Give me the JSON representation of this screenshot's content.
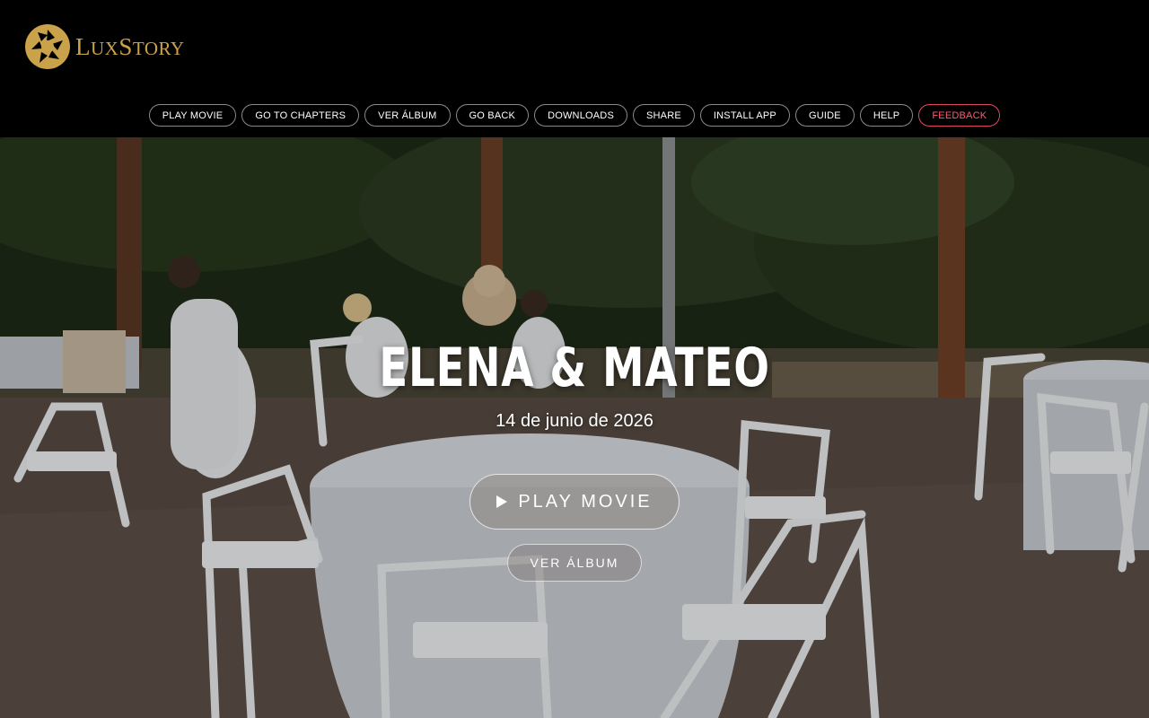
{
  "brand": {
    "name_first": "L",
    "name_rest": "UX",
    "name_second": "S",
    "name_second_rest": "TORY",
    "logo_icon": "aperture-logo-icon",
    "accent": "#c9a24a"
  },
  "nav": {
    "items": [
      {
        "label": "PLAY MOVIE"
      },
      {
        "label": "GO TO CHAPTERS"
      },
      {
        "label": "VER ÁLBUM"
      },
      {
        "label": "GO BACK"
      },
      {
        "label": "DOWNLOADS"
      },
      {
        "label": "SHARE"
      },
      {
        "label": "INSTALL APP"
      },
      {
        "label": "GUIDE"
      },
      {
        "label": "HELP"
      },
      {
        "label": "FEEDBACK"
      }
    ],
    "feedback_color": "#ff5b70"
  },
  "hero": {
    "title": "ELENA & MATEO",
    "date": "14 de junio de 2026",
    "play_label": "PLAY MOVIE",
    "play_icon": "play-icon",
    "album_label": "VER ÁLBUM"
  }
}
